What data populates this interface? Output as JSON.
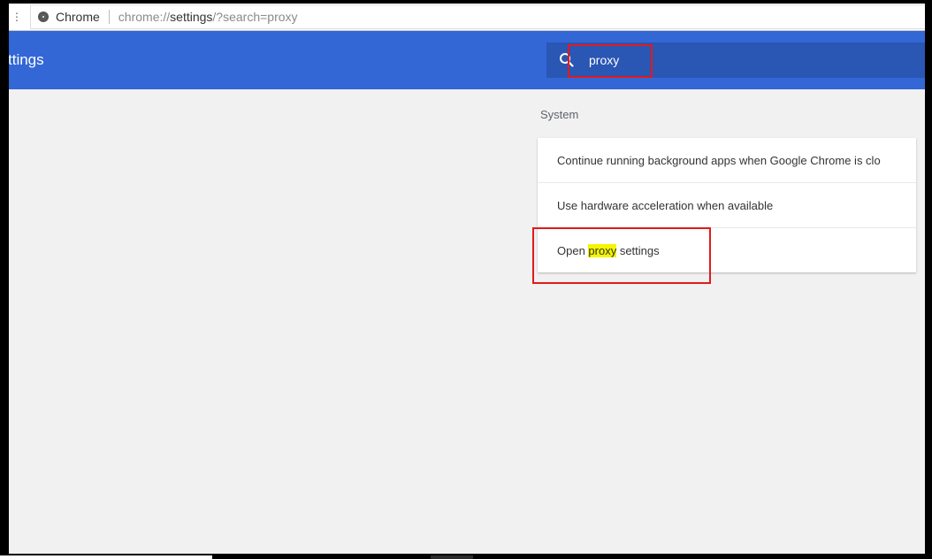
{
  "browser": {
    "site_name": "Chrome",
    "url_prefix": "chrome://",
    "url_strong": "settings",
    "url_suffix": "/?search=proxy"
  },
  "header": {
    "title": "ttings"
  },
  "search": {
    "value": "proxy",
    "icon": "search-icon"
  },
  "section": {
    "title": "System"
  },
  "settings": {
    "row1": "Continue running background apps when Google Chrome is clo",
    "row2": "Use hardware acceleration when available",
    "row3_before": "Open ",
    "row3_highlight": "proxy",
    "row3_after": " settings"
  },
  "colors": {
    "header_blue": "#3367d6",
    "search_bg": "#2a56b4",
    "highlight": "#f5f500",
    "annotation_red": "#e01b1b"
  }
}
